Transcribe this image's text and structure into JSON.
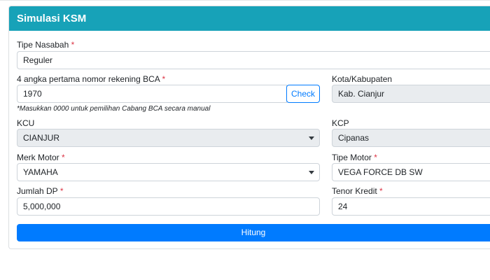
{
  "card": {
    "title": "Simulasi KSM"
  },
  "form": {
    "required_mark": "*",
    "tipe_nasabah": {
      "label": "Tipe Nasabah",
      "value": "Reguler"
    },
    "rekening": {
      "label": "4 angka pertama nomor rekening BCA",
      "value": "1970",
      "check_label": "Check",
      "hint": "*Masukkan 0000 untuk pemilihan Cabang BCA secara manual"
    },
    "kota": {
      "label": "Kota/Kabupaten",
      "value": "Kab. Cianjur"
    },
    "kcu": {
      "label": "KCU",
      "value": "CIANJUR"
    },
    "kcp": {
      "label": "KCP",
      "value": "Cipanas"
    },
    "merk_motor": {
      "label": "Merk Motor",
      "value": "YAMAHA"
    },
    "tipe_motor": {
      "label": "Tipe Motor",
      "value": "VEGA FORCE DB SW"
    },
    "jumlah_dp": {
      "label": "Jumlah DP",
      "value": "5,000,000"
    },
    "tenor": {
      "label": "Tenor Kredit",
      "value": "24"
    },
    "submit_label": "Hitung"
  },
  "colors": {
    "header": "#17a2b8",
    "primary": "#007bff",
    "required": "#dc3545",
    "disabled_bg": "#e9ecef"
  }
}
